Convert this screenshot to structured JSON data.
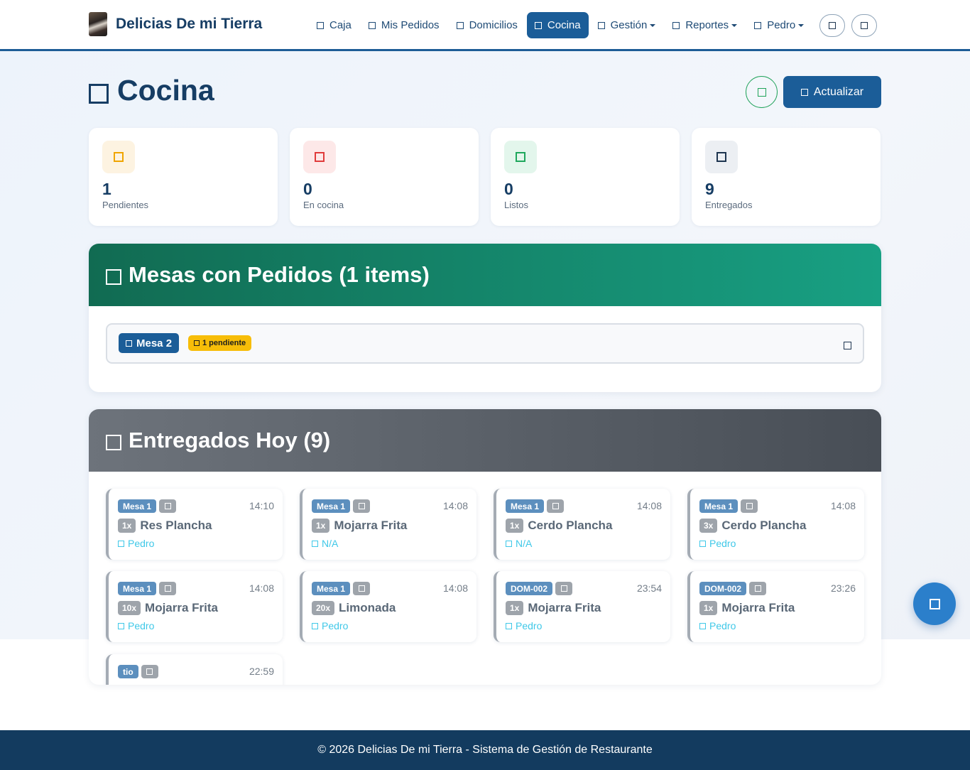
{
  "brand": {
    "name": "Delicias De mi Tierra"
  },
  "nav": {
    "items": [
      {
        "label": "Caja",
        "icon": "square-icon",
        "dropdown": false,
        "active": false
      },
      {
        "label": "Mis Pedidos",
        "icon": "square-icon",
        "dropdown": false,
        "active": false
      },
      {
        "label": "Domicilios",
        "icon": "square-icon",
        "dropdown": false,
        "active": false
      },
      {
        "label": "Cocina",
        "icon": "square-icon",
        "dropdown": false,
        "active": true
      },
      {
        "label": "Gestión",
        "icon": "square-icon",
        "dropdown": true,
        "active": false
      },
      {
        "label": "Reportes",
        "icon": "square-icon",
        "dropdown": true,
        "active": false
      },
      {
        "label": "Pedro",
        "icon": "square-icon",
        "dropdown": true,
        "active": false
      }
    ]
  },
  "header": {
    "title": "Cocina",
    "refresh_label": "Actualizar"
  },
  "stats": [
    {
      "value": "1",
      "label": "Pendientes",
      "color": "#f0a500",
      "bg": "#fdf3e1"
    },
    {
      "value": "0",
      "label": "En cocina",
      "color": "#e03b3b",
      "bg": "#fde8e8"
    },
    {
      "value": "0",
      "label": "Listos",
      "color": "#1fa85d",
      "bg": "#e3f6ec"
    },
    {
      "value": "9",
      "label": "Entregados",
      "color": "#1e3550",
      "bg": "#eceff3"
    }
  ],
  "mesas": {
    "title": "Mesas con Pedidos (1 items)",
    "rows": [
      {
        "mesa": "Mesa 2",
        "status": "1 pendiente"
      }
    ]
  },
  "entregados": {
    "title": "Entregados Hoy (9)",
    "items": [
      {
        "tag": "Mesa 1",
        "time": "14:10",
        "qty": "1x",
        "name": "Res Plancha",
        "user": "Pedro"
      },
      {
        "tag": "Mesa 1",
        "time": "14:08",
        "qty": "1x",
        "name": "Mojarra Frita",
        "user": "N/A"
      },
      {
        "tag": "Mesa 1",
        "time": "14:08",
        "qty": "1x",
        "name": "Cerdo Plancha",
        "user": "N/A"
      },
      {
        "tag": "Mesa 1",
        "time": "14:08",
        "qty": "3x",
        "name": "Cerdo Plancha",
        "user": "Pedro"
      },
      {
        "tag": "Mesa 1",
        "time": "14:08",
        "qty": "10x",
        "name": "Mojarra Frita",
        "user": "Pedro"
      },
      {
        "tag": "Mesa 1",
        "time": "14:08",
        "qty": "20x",
        "name": "Limonada",
        "user": "Pedro"
      },
      {
        "tag": "DOM-002",
        "time": "23:54",
        "qty": "1x",
        "name": "Mojarra Frita",
        "user": "Pedro"
      },
      {
        "tag": "DOM-002",
        "time": "23:26",
        "qty": "1x",
        "name": "Mojarra Frita",
        "user": "Pedro"
      },
      {
        "tag": "tio",
        "time": "22:59",
        "qty": "",
        "name": "",
        "user": ""
      }
    ]
  },
  "footer": {
    "text": "© 2026 Delicias De mi Tierra - Sistema de Gestión de Restaurante"
  },
  "colors": {
    "primary": "#1b5d98",
    "navy": "#163d64",
    "success": "#1fa85d",
    "warning": "#f7bd08",
    "info": "#3fc8e8"
  }
}
